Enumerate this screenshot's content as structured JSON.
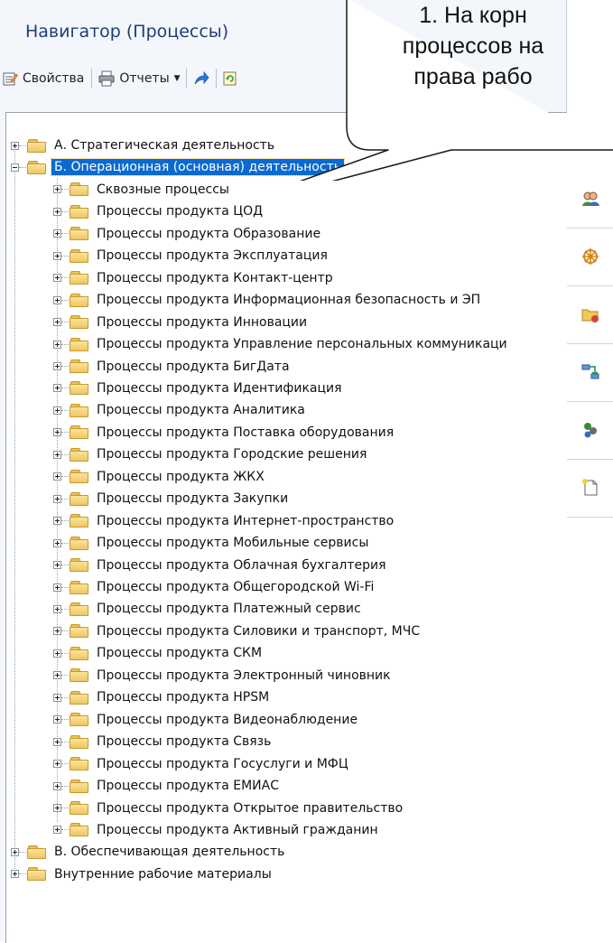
{
  "navigator": {
    "title": "Навигатор (Процессы)"
  },
  "toolbar": {
    "properties_label": "Свойства",
    "reports_label": "Отчеты"
  },
  "callout": {
    "line1": "1. На корн",
    "line2": "процессов на",
    "line3": "права рабо"
  },
  "tree": {
    "root_items": [
      "А. Стратегическая деятельность",
      "Б. Операционная (основная) деятельность",
      "В. Обеспечивающая деятельность",
      "Внутренние рабочие материалы"
    ],
    "children": [
      "Сквозные процессы",
      "Процессы продукта ЦОД",
      "Процессы продукта Образование",
      "Процессы продукта Эксплуатация",
      "Процессы продукта Контакт-центр",
      "Процессы продукта Информационная безопасность и ЭП",
      "Процессы продукта Инновации",
      "Процессы продукта Управление персональных коммуникаци",
      "Процессы продукта БигДата",
      "Процессы продукта Идентификация",
      "Процессы продукта Аналитика",
      "Процессы продукта Поставка оборудования",
      "Процессы продукта Городские решения",
      "Процессы продукта ЖКХ",
      "Процессы продукта Закупки",
      "Процессы продукта Интернет-пространство",
      "Процессы продукта Мобильные сервисы",
      "Процессы продукта Облачная бухгалтерия",
      "Процессы продукта Общегородской Wi-Fi",
      "Процессы продукта Платежный сервис",
      "Процессы продукта Силовики и транспорт, МЧС",
      "Процессы продукта СКМ",
      "Процессы продукта Электронный чиновник",
      "Процессы продукта HPSM",
      "Процессы продукта Видеонаблюдение",
      "Процессы продукта Связь",
      "Процессы продукта Госуслуги и МФЦ",
      "Процессы продукта ЕМИАС",
      "Процессы продукта Открытое правительство",
      "Процессы продукта Активный гражданин"
    ]
  },
  "icons": {
    "properties": "properties-icon",
    "reports": "printer-icon",
    "forward": "arrow-icon",
    "refresh": "refresh-icon",
    "folder": "folder-icon",
    "sidebar": [
      "users-icon",
      "wheel-icon",
      "folder-settings-icon",
      "structure-icon",
      "org-icon",
      "new-document-icon"
    ]
  },
  "colors": {
    "selection": "#0a6ad2",
    "title": "#1e3f74",
    "folder": "#eec764"
  }
}
